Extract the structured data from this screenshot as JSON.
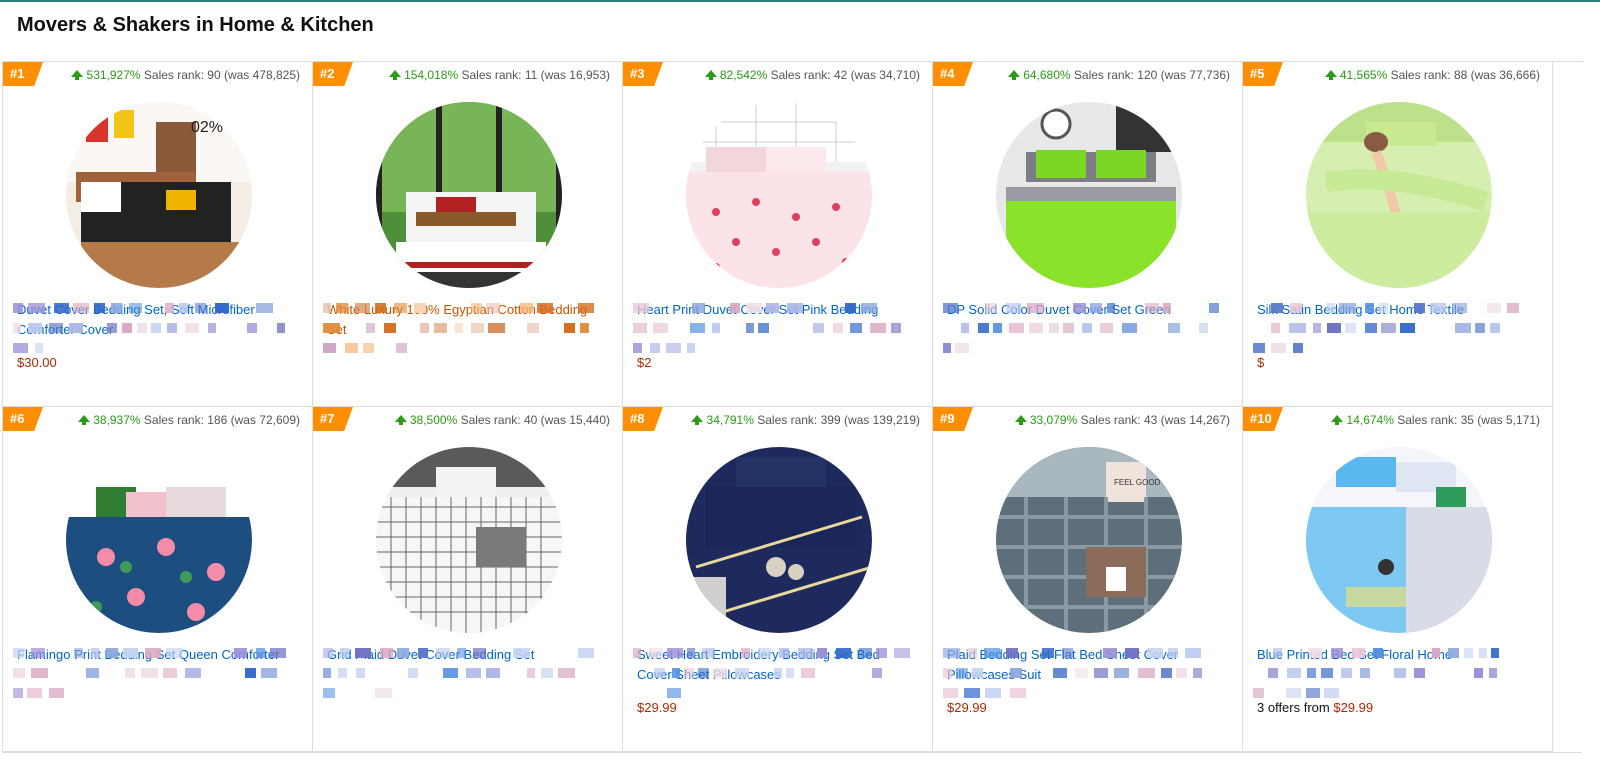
{
  "page_title": "Movers & Shakers in Home & Kitchen",
  "products": [
    {
      "rank": "#1",
      "pct": "531,927%",
      "sales": "Sales rank: 90 (was 478,825)",
      "title": "Duvet Cover Bedding Set, Soft Microfiber Comforter Cover",
      "price": "$30.00",
      "offers": "",
      "image": "black-bedding",
      "title_color": "blue"
    },
    {
      "rank": "#2",
      "pct": "154,018%",
      "sales": "Sales rank: 11 (was 16,953)",
      "title": "White Luxury 100% Egyptian Cotton Bedding Set",
      "price": "",
      "offers": "",
      "image": "white-bedding",
      "title_color": "orange"
    },
    {
      "rank": "#3",
      "pct": "82,542%",
      "sales": "Sales rank: 42 (was 34,710)",
      "title": "Heart Print Duvet Cover Set Pink Bedding",
      "price": "$2",
      "offers": "",
      "image": "heart-bedding",
      "title_color": "blue"
    },
    {
      "rank": "#4",
      "pct": "64,680%",
      "sales": "Sales rank: 120 (was 77,736)",
      "title": "DP Solid Color Duvet Cover Set Green",
      "price": "",
      "offers": "",
      "image": "green-bedding",
      "title_color": "blue"
    },
    {
      "rank": "#5",
      "pct": "41,565%",
      "sales": "Sales rank: 88 (was 36,666)",
      "title": "Silk Satin Bedding Set Home Textile",
      "price": "$",
      "offers": "",
      "image": "satin-bedding",
      "title_color": "blue"
    },
    {
      "rank": "#6",
      "pct": "38,937%",
      "sales": "Sales rank: 186 (was 72,609)",
      "title": "Flamingo Print Bedding Set Queen Comforter",
      "price": "",
      "offers": "",
      "image": "flamingo-bedding",
      "title_color": "blue"
    },
    {
      "rank": "#7",
      "pct": "38,500%",
      "sales": "Sales rank: 40 (was 15,440)",
      "title": "Grid Plaid Duvet Cover Bedding Set",
      "price": "",
      "offers": "",
      "image": "grid-bedding",
      "title_color": "blue"
    },
    {
      "rank": "#8",
      "pct": "34,791%",
      "sales": "Sales rank: 399 (was 139,219)",
      "title": "Sweet Heart Embroidery Bedding Set Bed Cover Sheet Pillowcases",
      "price": "$29.99",
      "offers": "",
      "image": "navy-bedding",
      "title_color": "blue"
    },
    {
      "rank": "#9",
      "pct": "33,079%",
      "sales": "Sales rank: 43 (was 14,267)",
      "title": "Plaid Bedding Set Flat Bed Sheet Cover Pillowcases Suit",
      "price": "$29.99",
      "offers": "",
      "image": "plaid-bedding",
      "title_color": "blue"
    },
    {
      "rank": "#10",
      "pct": "14,674%",
      "sales": "Sales rank: 35 (was 5,171)",
      "title": "Blue Printed Bed Set Floral Home",
      "price": "$29.99",
      "offers": "3 offers from ",
      "image": "blue-bedding",
      "title_color": "blue"
    }
  ]
}
